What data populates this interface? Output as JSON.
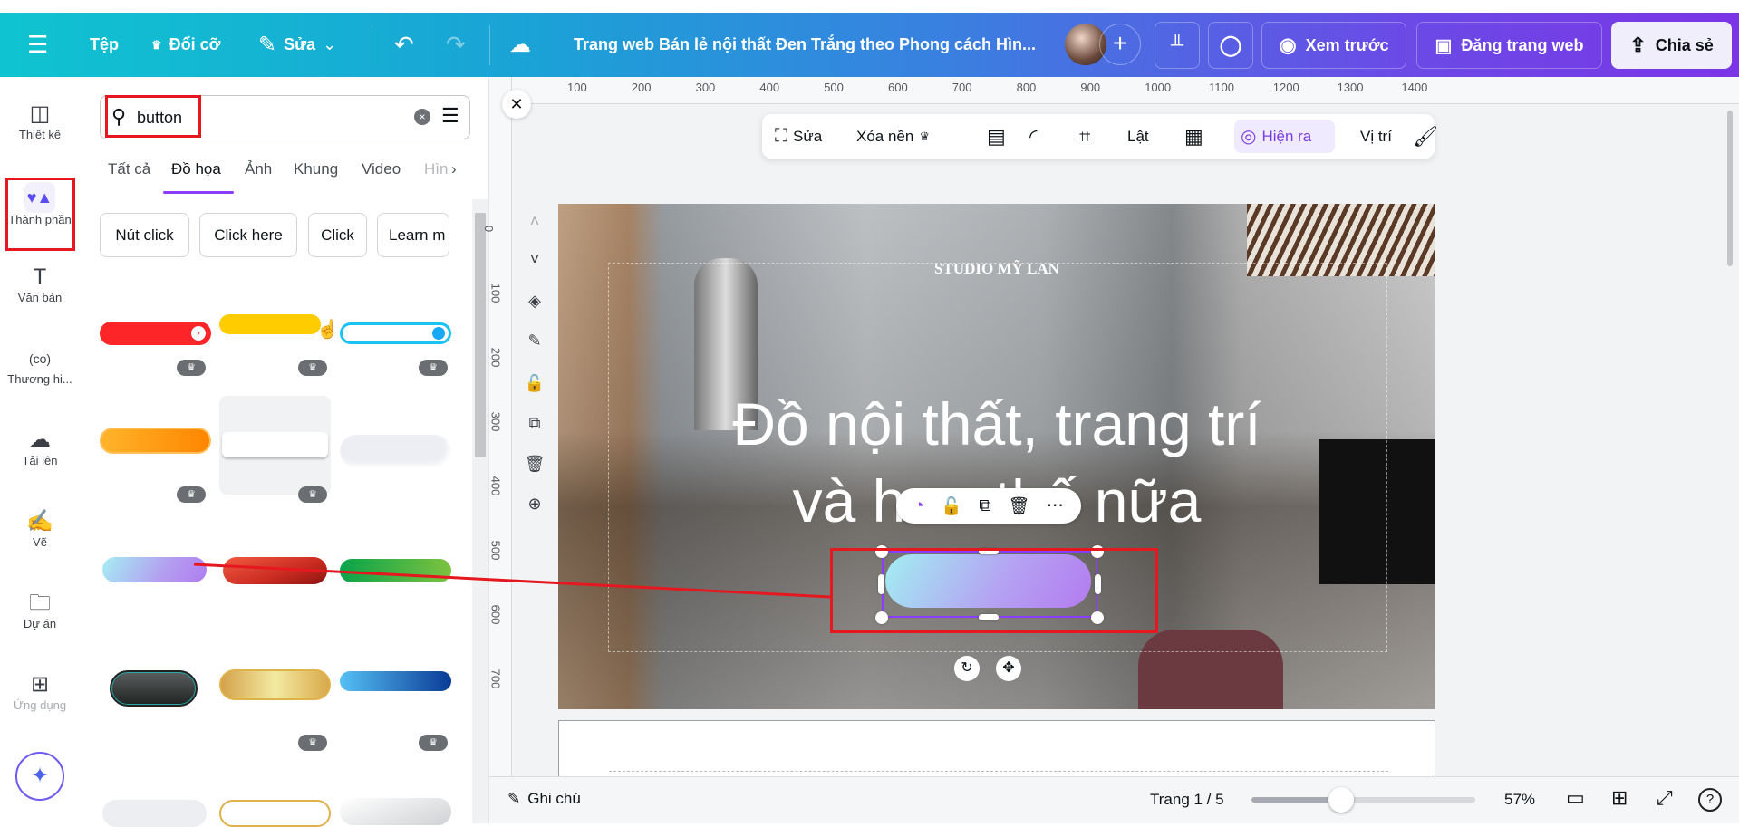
{
  "topbar": {
    "menu_icon": "hamburger-icon",
    "file": "Tệp",
    "resize": "Đổi cỡ",
    "edit": "Sửa",
    "title": "Trang web Bán lẻ nội thất Đen Trắng theo Phong cách Hìn...",
    "preview": "Xem trước",
    "publish": "Đăng trang web",
    "share": "Chia sẻ"
  },
  "rail": {
    "items": [
      {
        "label": "Thiết kế",
        "icon": "layout-icon"
      },
      {
        "label": "Thành phần",
        "icon": "elements-icon"
      },
      {
        "label": "Văn bản",
        "icon": "text-icon"
      },
      {
        "label": "Thương hi...",
        "icon": "brand-icon"
      },
      {
        "label": "Tải lên",
        "icon": "upload-cloud-icon"
      },
      {
        "label": "Vẽ",
        "icon": "draw-icon"
      },
      {
        "label": "Dự án",
        "icon": "folder-icon"
      },
      {
        "label": "Ứng dụng",
        "icon": "apps-icon"
      }
    ]
  },
  "panel": {
    "search_value": "button",
    "tabs": [
      "Tất cả",
      "Đồ họa",
      "Ảnh",
      "Khung",
      "Video",
      "Hìn"
    ],
    "active_tab": "Đồ họa",
    "chips": [
      "Nút click",
      "Click here",
      "Click",
      "Learn m"
    ]
  },
  "toolbar": {
    "edit": "Sửa",
    "remove_bg": "Xóa nền",
    "flip": "Lật",
    "animate": "Hiện ra",
    "position": "Vị trí"
  },
  "ruler": {
    "h": [
      "100",
      "200",
      "300",
      "400",
      "500",
      "600",
      "700",
      "800",
      "900",
      "1000",
      "1100",
      "1200",
      "1300",
      "1400"
    ],
    "v": [
      "0",
      "100",
      "200",
      "300",
      "400",
      "500",
      "600",
      "700"
    ]
  },
  "design": {
    "brand": "STUDIO MỸ LAN",
    "headline1": "Đồ nội thất, trang trí",
    "headline2": "và hơn thế nữa"
  },
  "bottombar": {
    "notes": "Ghi chú",
    "page": "Trang 1 / 5",
    "zoom": "57%",
    "zoom_level_percent": 57
  },
  "colors": {
    "accent": "#8b3dff",
    "annotation": "#e5181f"
  }
}
